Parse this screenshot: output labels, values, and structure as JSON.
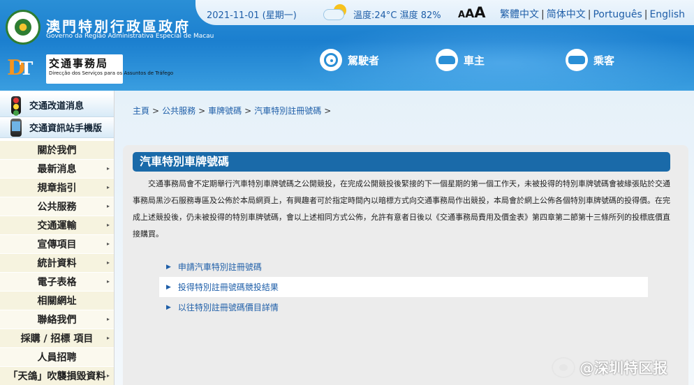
{
  "header": {
    "gov_title": "澳門特別行政區政府",
    "gov_subtitle": "Governo da Região Administrativa Especial de Macau",
    "dsat_title": "交通事務局",
    "dsat_subtitle": "Direcção dos Serviços para os Assuntos de Tráfego",
    "date": "2021-11-01 (星期一)",
    "weather": "溫度:24°C 濕度 82%",
    "font_size": [
      "A",
      "A",
      "A"
    ],
    "languages": [
      "繁體中文",
      "简体中文",
      "Português",
      "English"
    ],
    "nav": [
      {
        "label": "駕駛者",
        "icon": "steering-wheel-icon"
      },
      {
        "label": "車主",
        "icon": "car-icon"
      },
      {
        "label": "乘客",
        "icon": "bus-icon"
      }
    ]
  },
  "sidebar": {
    "promos": [
      {
        "label": "交通改道消息",
        "icon": "traffic-light-icon"
      },
      {
        "label": "交通資訊站手機版",
        "icon": "mobile-phone-icon"
      }
    ],
    "menu": [
      {
        "label": "關於我們",
        "has_arrow": false
      },
      {
        "label": "最新消息",
        "has_arrow": true
      },
      {
        "label": "規章指引",
        "has_arrow": true
      },
      {
        "label": "公共服務",
        "has_arrow": true
      },
      {
        "label": "交通運輸",
        "has_arrow": true
      },
      {
        "label": "宣傳項目",
        "has_arrow": true
      },
      {
        "label": "統計資料",
        "has_arrow": true
      },
      {
        "label": "電子表格",
        "has_arrow": true
      },
      {
        "label": "相關網址",
        "has_arrow": false
      },
      {
        "label": "聯絡我們",
        "has_arrow": true
      },
      {
        "label": "採購 / 招標 項目",
        "has_arrow": true
      },
      {
        "label": "人員招聘",
        "has_arrow": false
      },
      {
        "label": "「天鴿」吹襲損毀資料",
        "has_arrow": true
      }
    ]
  },
  "breadcrumb": [
    "主頁",
    "公共服務",
    "車牌號碼",
    "汽車特別註冊號碼"
  ],
  "content": {
    "title": "汽車特別車牌號碼",
    "description": "交通事務局會不定期舉行汽車特別車牌號碼之公開競投，在完成公開競投後緊接的下一個星期的第一個工作天，未被投得的特別車牌號碼會被緣張貼於交通事務局黑沙石服務專區及公佈於本局網頁上，有興趣者可於指定時間內以暗標方式向交通事務局作出競投，本局會於網上公佈各個特別車牌號碼的投得價。在完成上述競投後，仍未被投得的特別車牌號碼，會以上述相同方式公佈，允許有意者日後以《交通事務局費用及價金表》第四章第二節第十三條所列的投標底價直接購買。",
    "links": [
      "申請汽車特別註冊號碼",
      "投得特別註冊號碼競投結果",
      "以往特別註冊號碼價目詳情"
    ]
  },
  "watermark": "@深圳特区报",
  "colors": {
    "header_blue": "#2a8fd6",
    "title_bar": "#1a6aa9",
    "link": "#1e5ea8",
    "sidebar_odd": "#f6f3df"
  }
}
